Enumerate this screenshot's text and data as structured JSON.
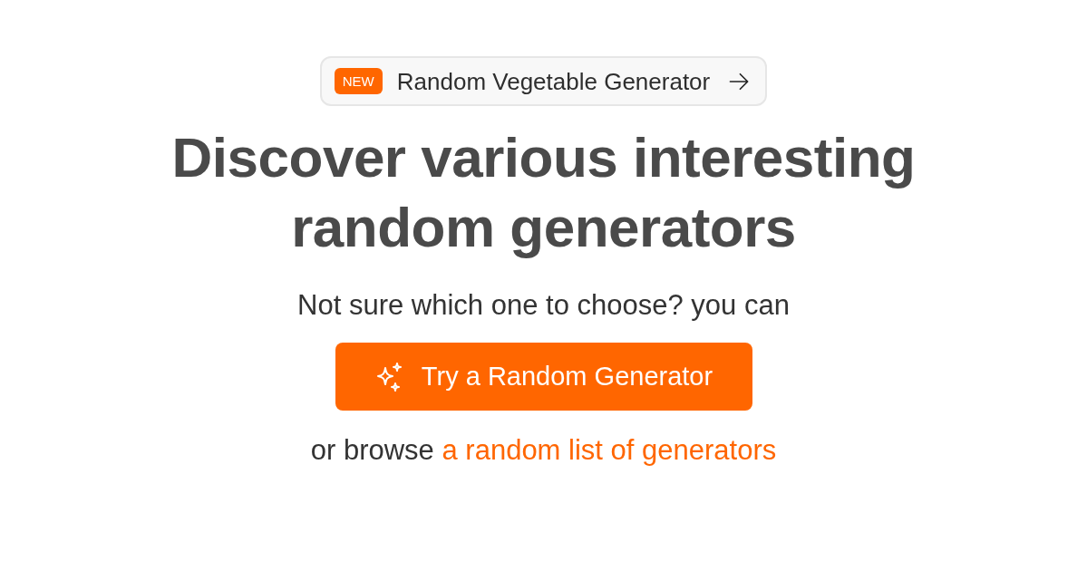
{
  "announcement": {
    "badge": "NEW",
    "label": "Random Vegetable Generator"
  },
  "heading": "Discover various interesting random generators",
  "subtitle": "Not sure which one to choose? you can",
  "primary_button": {
    "label": "Try a Random Generator"
  },
  "browse_line": {
    "text": "or browse",
    "link": "a random list of generators"
  }
}
